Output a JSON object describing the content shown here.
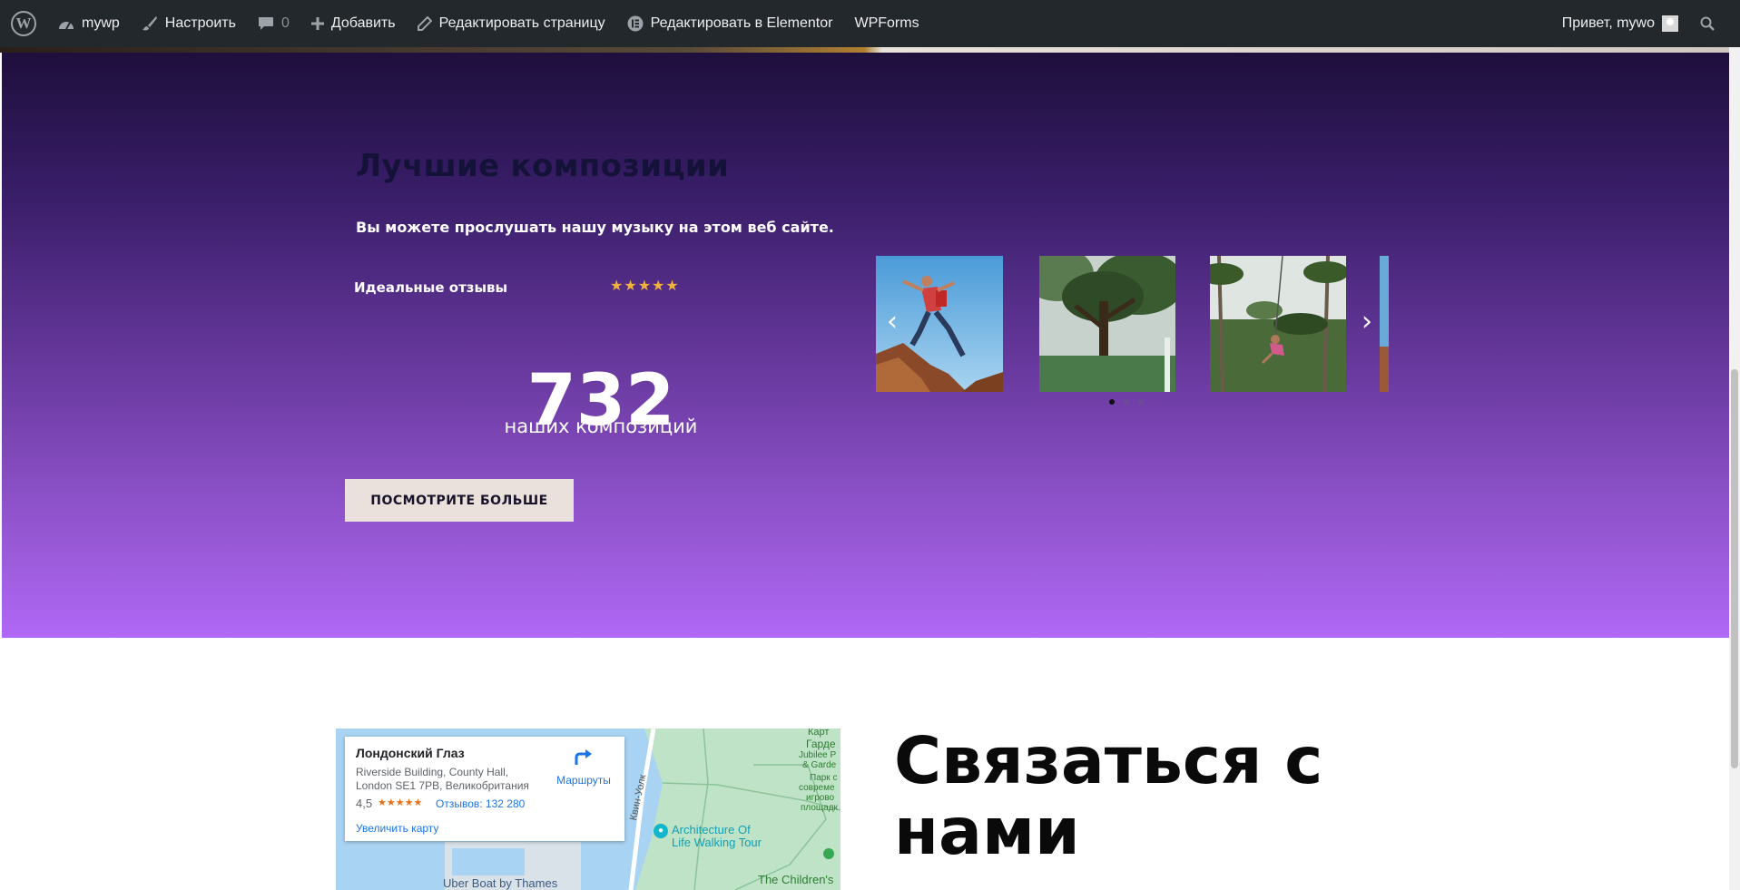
{
  "admin_bar": {
    "site_name": "mywp",
    "customize": "Настроить",
    "comments_count": "0",
    "add_new": "Добавить",
    "edit_page": "Редактировать страницу",
    "edit_elementor": "Редактировать в Elementor",
    "wpforms": "WPForms",
    "greeting": "Привет, mywo",
    "icons": [
      "wordpress-logo-icon",
      "dashboard-icon",
      "brush-icon",
      "comment-icon",
      "plus-icon",
      "pencil-icon",
      "elementor-icon",
      "avatar-icon",
      "search-icon"
    ]
  },
  "music": {
    "title": "Лучшие композиции",
    "subtitle": "Вы можете прослушать нашу музыку на этом веб сайте.",
    "rating_label": "Идеальные отзывы",
    "rating_stars": "★★★★★",
    "rating_value": 5,
    "counter_number": "732",
    "counter_label": "наших композиций",
    "button_label": "ПОСМОТРИТЕ БОЛЬШЕ",
    "carousel": {
      "prev_symbol": "‹",
      "next_symbol": "›",
      "slides": [
        "man-jumping-photo",
        "tree-forest-photo",
        "woman-swing-jungle-photo",
        "partial-slide-photo"
      ],
      "dot_count": 3,
      "active_dot": 1
    },
    "colors": {
      "gradient_top": "#1e0f3c",
      "gradient_bottom": "#b068f6",
      "title": "#15123a",
      "button_bg": "#eae0dc",
      "stars": "#f0b23a"
    }
  },
  "map": {
    "place_name": "Лондонский Глаз",
    "address_line1": "Riverside Building, County Hall,",
    "address_line2": "London SE1 7PB, Великобритания",
    "rating": "4,5",
    "stars": "★★★★★",
    "reviews": "Отзывов: 132 280",
    "directions": "Маршруты",
    "enlarge": "Увеличить карту",
    "labels": {
      "garden1": "Карт",
      "garden2": "Гарде",
      "garden3": "Jubilee P",
      "garden4": "& Garde",
      "garden5": "Парк с",
      "garden6": "совреме",
      "garden7": "игрово",
      "garden8": "площадк",
      "street": "Квин-Уолк",
      "attraction1": "Architecture Of",
      "attraction2": "Life Walking Tour",
      "uber": "Uber Boat by Thames",
      "children": "The Children's"
    }
  },
  "contact": {
    "title": "Связаться с нами"
  }
}
